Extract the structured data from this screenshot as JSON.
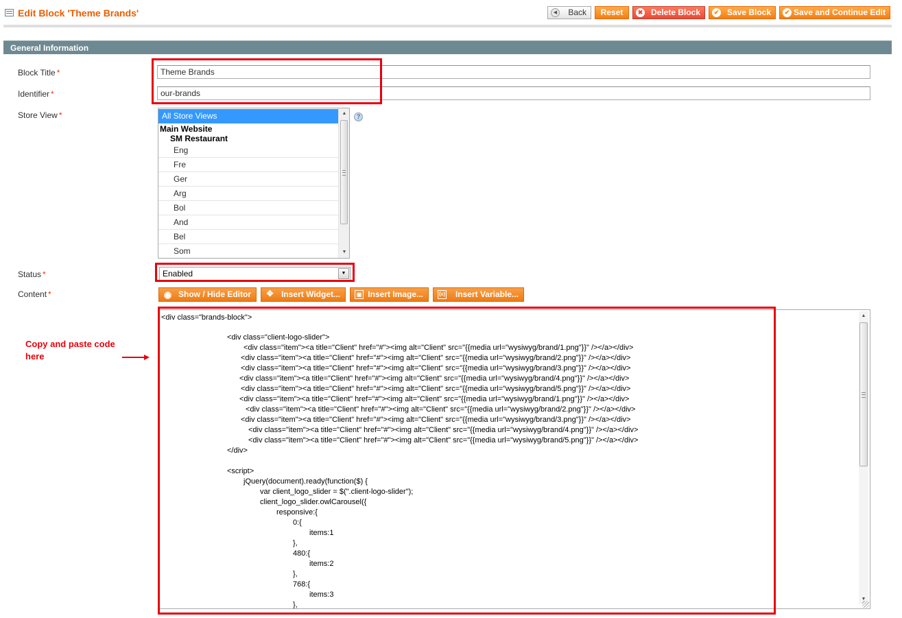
{
  "header": {
    "title": "Edit Block 'Theme Brands'",
    "buttons": {
      "back": "Back",
      "reset": "Reset",
      "delete": "Delete Block",
      "save": "Save Block",
      "save_continue": "Save and Continue Edit"
    }
  },
  "section": {
    "title": "General Information"
  },
  "form": {
    "block_title": {
      "label": "Block Title",
      "required": "*",
      "value": "Theme Brands"
    },
    "identifier": {
      "label": "Identifier",
      "required": "*",
      "value": "our-brands"
    },
    "store_view": {
      "label": "Store View",
      "required": "*",
      "selected": "All Store Views",
      "group_website": "Main Website",
      "group_store": "SM Restaurant",
      "views": [
        "Eng",
        "Fre",
        "Ger",
        "Arg",
        "Bol",
        "And",
        "Bel",
        "Som"
      ]
    },
    "status": {
      "label": "Status",
      "required": "*",
      "value": "Enabled"
    },
    "content": {
      "label": "Content",
      "required": "*",
      "toolbar": {
        "show_hide": "Show / Hide Editor",
        "insert_widget": "Insert Widget...",
        "insert_image": "Insert Image...",
        "insert_variable": "Insert Variable..."
      },
      "code_lines": [
        "<div class=\"brands-block\">",
        "<div class=\"client-logo-slider\">",
        "<div class=\"item\"><a title=\"Client\" href=\"#\"><img alt=\"Client\" src=\"{{media url=\"wysiwyg/brand/1.png\"}}\" /></a></div>",
        "<div class=\"item\"><a title=\"Client\" href=\"#\"><img alt=\"Client\" src=\"{{media url=\"wysiwyg/brand/2.png\"}}\" /></a></div>",
        "<div class=\"item\"><a title=\"Client\" href=\"#\"><img alt=\"Client\" src=\"{{media url=\"wysiwyg/brand/3.png\"}}\" /></a></div>",
        "<div class=\"item\"><a title=\"Client\" href=\"#\"><img alt=\"Client\" src=\"{{media url=\"wysiwyg/brand/4.png\"}}\" /></a></div>",
        "<div class=\"item\"><a title=\"Client\" href=\"#\"><img alt=\"Client\" src=\"{{media url=\"wysiwyg/brand/5.png\"}}\" /></a></div>",
        "<div class=\"item\"><a title=\"Client\" href=\"#\"><img alt=\"Client\" src=\"{{media url=\"wysiwyg/brand/1.png\"}}\" /></a></div>",
        "<div class=\"item\"><a title=\"Client\" href=\"#\"><img alt=\"Client\" src=\"{{media url=\"wysiwyg/brand/2.png\"}}\" /></a></div>",
        "<div class=\"item\"><a title=\"Client\" href=\"#\"><img alt=\"Client\" src=\"{{media url=\"wysiwyg/brand/3.png\"}}\" /></a></div>",
        "<div class=\"item\"><a title=\"Client\" href=\"#\"><img alt=\"Client\" src=\"{{media url=\"wysiwyg/brand/4.png\"}}\" /></a></div>",
        "<div class=\"item\"><a title=\"Client\" href=\"#\"><img alt=\"Client\" src=\"{{media url=\"wysiwyg/brand/5.png\"}}\" /></a></div>",
        "</div>",
        "<script>",
        "jQuery(document).ready(function($) {",
        "var client_logo_slider = $(\".client-logo-slider\");",
        "client_logo_slider.owlCarousel({",
        "responsive:{",
        "0:{",
        "items:1",
        "},",
        "480:{",
        "items:2",
        "},",
        "768:{",
        "items:3",
        "},"
      ]
    }
  },
  "annotation": {
    "line1": "Copy and paste code",
    "line2": "here"
  },
  "colors": {
    "accent": "#eb5e00",
    "section_header": "#6f8992",
    "highlight": "#e8000b",
    "selection": "#3399ff"
  }
}
